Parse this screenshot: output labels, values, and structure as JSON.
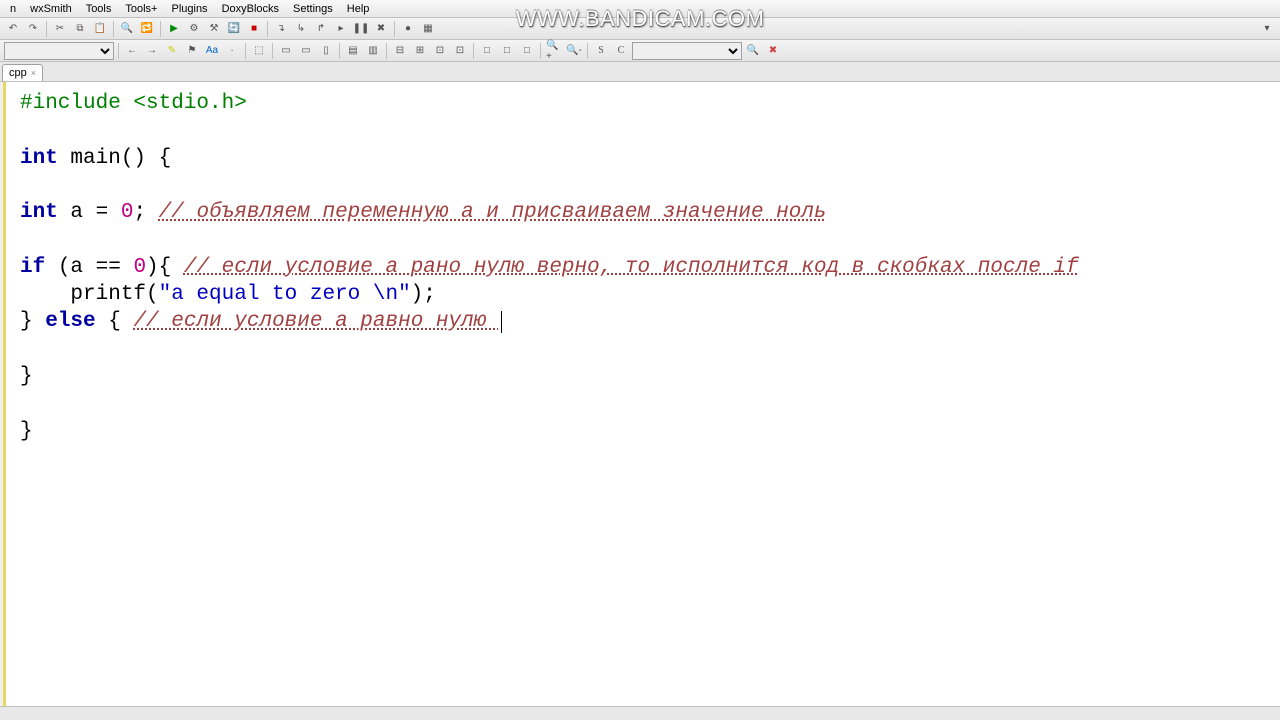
{
  "menubar": [
    "n",
    "wxSmith",
    "Tools",
    "Tools+",
    "Plugins",
    "DoxyBlocks",
    "Settings",
    "Help"
  ],
  "watermark": "www.BANDICAM.com",
  "tab": {
    "label": "cpp",
    "close": "×"
  },
  "code": {
    "l1_pp": "#include <stdio.h>",
    "l3_kw": "int",
    "l3_rest": " main() {",
    "l5_kw": "int",
    "l5_rest1": " a = ",
    "l5_num": "0",
    "l5_rest2": "; ",
    "l5_cmt": "// объявляем переменную а и присваиваем значение ноль",
    "l7_kw": "if",
    "l7_rest1": " (a == ",
    "l7_num": "0",
    "l7_rest2": "){ ",
    "l7_cmt": "// если условие а рано нулю верно, то исполнится код в скобках после if",
    "l8_pre": "    printf(",
    "l8_str": "\"a equal to zero \\n\"",
    "l8_post": ");",
    "l9_pre": "} ",
    "l9_kw": "else",
    "l9_rest": " { ",
    "l9_cmt": "// если условие а равно нулю ",
    "l11": "}",
    "l13": "}"
  }
}
